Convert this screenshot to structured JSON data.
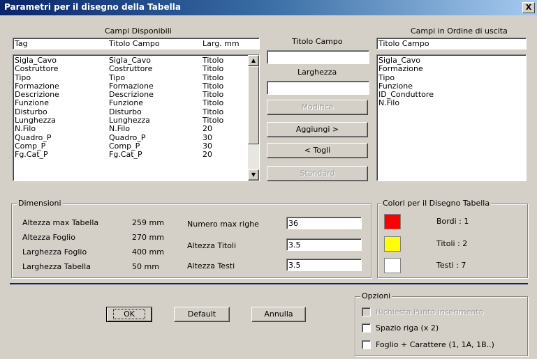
{
  "window": {
    "title": "Parametri per il disegno della Tabella",
    "close_label": "X"
  },
  "available": {
    "title": "Campi Disponibili",
    "headers": [
      "Tag",
      "Titolo Campo",
      "Larg. mm"
    ],
    "rows": [
      [
        "Sigla_Cavo",
        "Sigla_Cavo",
        "Titolo"
      ],
      [
        "Costruttore",
        "Costruttore",
        "Titolo"
      ],
      [
        "Tipo",
        "Tipo",
        "Titolo"
      ],
      [
        "Formazione",
        "Formazione",
        "Titolo"
      ],
      [
        "Descrizione",
        "Descrizione",
        "Titolo"
      ],
      [
        "Funzione",
        "Funzione",
        "Titolo"
      ],
      [
        "Disturbo",
        "Disturbo",
        "Titolo"
      ],
      [
        "Lunghezza",
        "Lunghezza",
        "Titolo"
      ],
      [
        "N.Filo",
        "N.Filo",
        "20"
      ],
      [
        "Quadro_P",
        "Quadro_P",
        "30"
      ],
      [
        "Comp_P",
        "Comp_P",
        "30"
      ],
      [
        "Fg.Cat_P",
        "Fg.Cat_P",
        "20"
      ]
    ]
  },
  "middle": {
    "titolo_label": "Titolo Campo",
    "titolo_value": "",
    "larghezza_label": "Larghezza",
    "larghezza_value": "",
    "modifica": "Modifica",
    "aggiungi": "Aggiungi >",
    "togli": "< Togli",
    "standard": "Standard"
  },
  "output": {
    "title": "Campi in Ordine di uscita",
    "header": "Titolo Campo",
    "items": [
      "Sigla_Cavo",
      "Formazione",
      "Tipo",
      "Funzione",
      "ID_Conduttore",
      "N.Filo"
    ]
  },
  "dimensioni": {
    "label": "Dimensioni",
    "items": [
      {
        "label": "Altezza max Tabella",
        "value": "259 mm"
      },
      {
        "label": "Altezza Foglio",
        "value": "270 mm"
      },
      {
        "label": "Larghezza Foglio",
        "value": "400 mm"
      },
      {
        "label": "Larghezza Tabella",
        "value": "50 mm"
      }
    ],
    "fields": [
      {
        "label": "Numero max righe",
        "value": "36"
      },
      {
        "label": "Altezza Titoli",
        "value": "3.5"
      },
      {
        "label": "Altezza Testi",
        "value": "3.5"
      }
    ]
  },
  "colori": {
    "label": "Colori per il Disegno Tabella",
    "items": [
      {
        "label": "Bordi : 1",
        "color": "#ff0000"
      },
      {
        "label": "Titoli : 2",
        "color": "#ffff00"
      },
      {
        "label": "Testi : 7",
        "color": "#ffffff"
      }
    ]
  },
  "buttons": {
    "ok": "OK",
    "default": "Default",
    "annulla": "Annulla"
  },
  "opzioni": {
    "label": "Opzioni",
    "items": [
      {
        "label": "Richiesta Punto inserimento",
        "disabled": true
      },
      {
        "label": "Spazio riga (x 2)",
        "disabled": false
      },
      {
        "label": "Foglio + Carattere (1, 1A, 1B..)",
        "disabled": false
      }
    ]
  }
}
